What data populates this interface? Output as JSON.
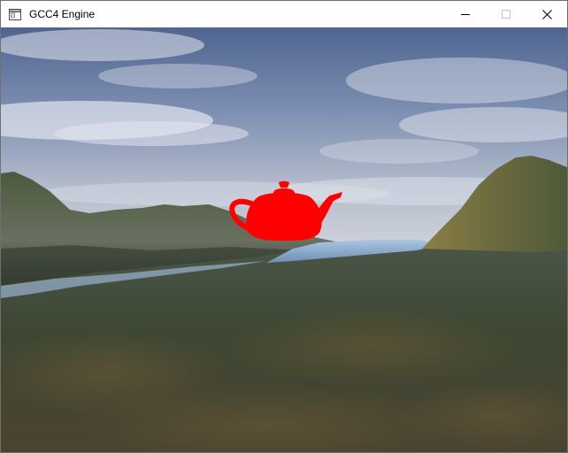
{
  "window": {
    "title": "GCC4 Engine",
    "icon": "app-window-icon",
    "controls": [
      {
        "name": "minimize-button",
        "icon": "minimize-icon"
      },
      {
        "name": "maximize-button",
        "icon": "maximize-icon",
        "disabled": true
      },
      {
        "name": "close-button",
        "icon": "close-icon"
      }
    ]
  },
  "scene": {
    "object": "teapot",
    "object_color": "#ff0000",
    "sky_color_top": "#5d7299",
    "sky_color_horizon": "#c7ccd6",
    "terrain_color": "#3f4a38",
    "water_color": "#8fb4d8"
  }
}
